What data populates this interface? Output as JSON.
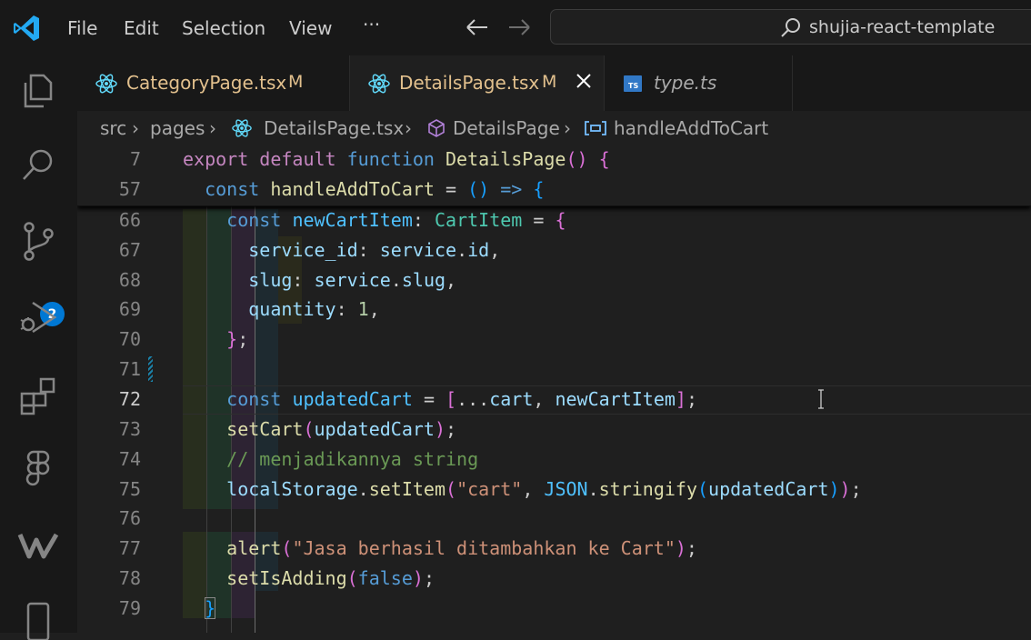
{
  "titlebar": {
    "menu": [
      "File",
      "Edit",
      "Selection",
      "View",
      "···"
    ],
    "search_text": "shujia-react-template"
  },
  "activity_bar": {
    "icons": [
      "explorer-icon",
      "search-icon",
      "source-control-icon",
      "run-debug-icon",
      "extensions-icon",
      "figma-icon",
      "wordpress-icon",
      "phone-icon"
    ],
    "source_control_badge": "2"
  },
  "tabs": [
    {
      "label": "CategoryPage.tsx",
      "modified": "M",
      "icon": "react-icon",
      "active": false
    },
    {
      "label": "DetailsPage.tsx",
      "modified": "M",
      "icon": "react-icon",
      "active": true
    },
    {
      "label": "type.ts",
      "modified": "",
      "icon": "typescript-icon",
      "active": false
    }
  ],
  "breadcrumb": [
    "src",
    "pages",
    "DetailsPage.tsx",
    "DetailsPage",
    "handleAddToCart"
  ],
  "editor": {
    "sticky_lines": [
      {
        "num": "7",
        "text": "export default function DetailsPage() {"
      },
      {
        "num": "57",
        "text": "  const handleAddToCart = () => {"
      }
    ],
    "lines": [
      {
        "num": "66",
        "text": "    const newCartItem: CartItem = {"
      },
      {
        "num": "67",
        "text": "      service_id: service.id,"
      },
      {
        "num": "68",
        "text": "      slug: service.slug,"
      },
      {
        "num": "69",
        "text": "      quantity: 1,"
      },
      {
        "num": "70",
        "text": "    };"
      },
      {
        "num": "71",
        "text": ""
      },
      {
        "num": "72",
        "text": "    const updatedCart = [...cart, newCartItem];"
      },
      {
        "num": "73",
        "text": "    setCart(updatedCart);"
      },
      {
        "num": "74",
        "text": "    // menjadikannya string"
      },
      {
        "num": "75",
        "text": "    localStorage.setItem(\"cart\", JSON.stringify(updatedCart));"
      },
      {
        "num": "76",
        "text": ""
      },
      {
        "num": "77",
        "text": "    alert(\"Jasa berhasil ditambahkan ke Cart\");"
      },
      {
        "num": "78",
        "text": "    setIsAdding(false);"
      },
      {
        "num": "79",
        "text": "  }"
      }
    ],
    "current_line": "72"
  },
  "colors": {
    "keyword_purple": "#c586c0",
    "keyword_blue": "#569cd6",
    "function": "#dcdcaa",
    "variable": "#9cdcfe",
    "type": "#4ec9b0",
    "string": "#ce9178",
    "comment": "#6a9955",
    "modified_tab": "#e2c08d",
    "badge": "#0078d4"
  }
}
